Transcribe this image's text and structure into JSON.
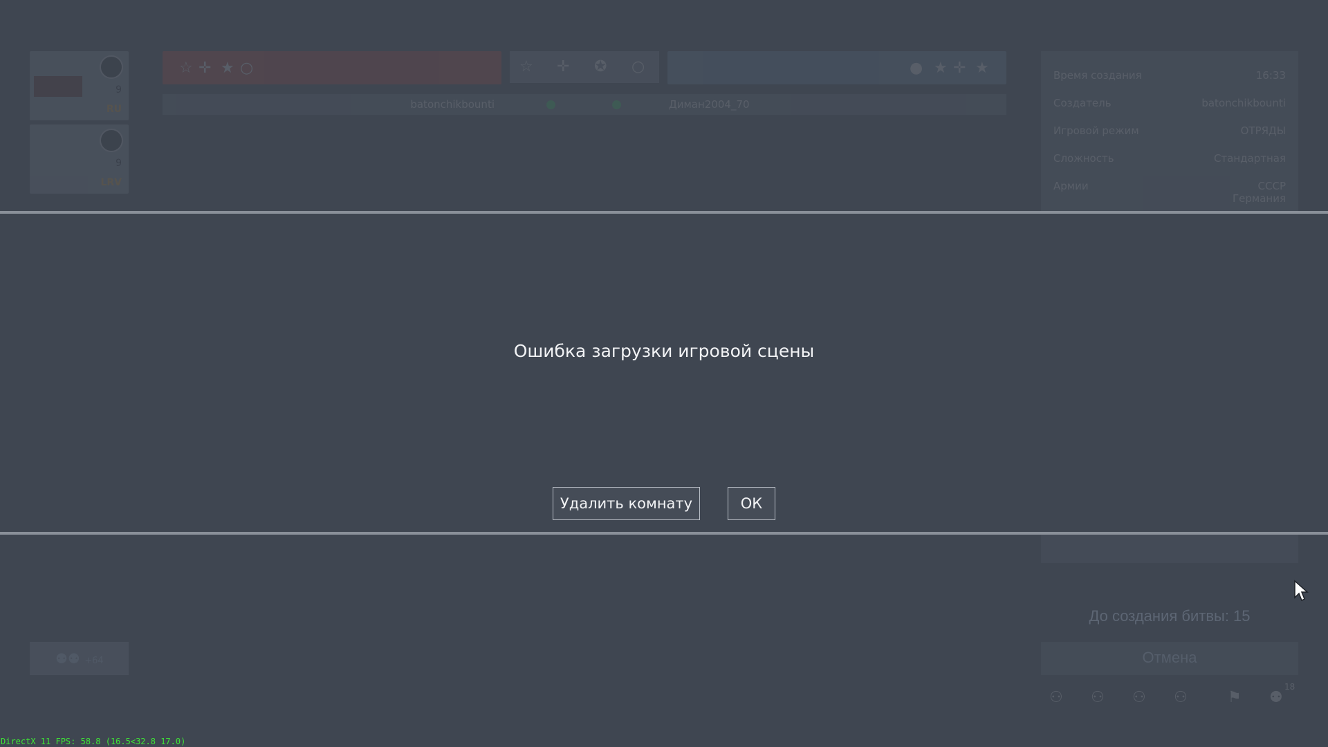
{
  "background": {
    "room_list": [
      {
        "players": "9",
        "tag": "RU"
      },
      {
        "players": "9",
        "tag": "LRV"
      }
    ],
    "team_left": {
      "icons": [
        "star-outline-icon",
        "cross-icon",
        "star-icon",
        "circle-icon"
      ]
    },
    "team_right": {
      "icons": [
        "roundel-icon",
        "star-icon",
        "cross-icon",
        "star-red-icon"
      ]
    },
    "faction_tabs": [
      "☆",
      "✛",
      "✪",
      "○"
    ],
    "player_row": {
      "left_player": "batonchikbounti",
      "right_player": "Диман2004_70"
    },
    "room_info": [
      {
        "key": "Время создания",
        "value": "16:33"
      },
      {
        "key": "Создатель",
        "value": "batonchikbounti"
      },
      {
        "key": "Игровой режим",
        "value": "ОТРЯДЫ"
      },
      {
        "key": "Сложность",
        "value": "Стандартная"
      },
      {
        "key": "Армии",
        "value": "СССР\nГермания"
      }
    ],
    "timer_text": "До создания битвы: 15",
    "cancel_label": "Отмена",
    "invite_count": "+64",
    "bottom_badge": "18"
  },
  "dialog": {
    "message": "Ошибка загрузки игровой сцены",
    "delete_room_label": "Удалить комнату",
    "ok_label": "ОК"
  },
  "overlay": {
    "fps_text": "DirectX 11 FPS: 58.8 (16.5<32.8 17.0)"
  },
  "colors": {
    "background": "#3f4651",
    "modal_border": "#8a9099",
    "fps_green": "#3ee636"
  }
}
